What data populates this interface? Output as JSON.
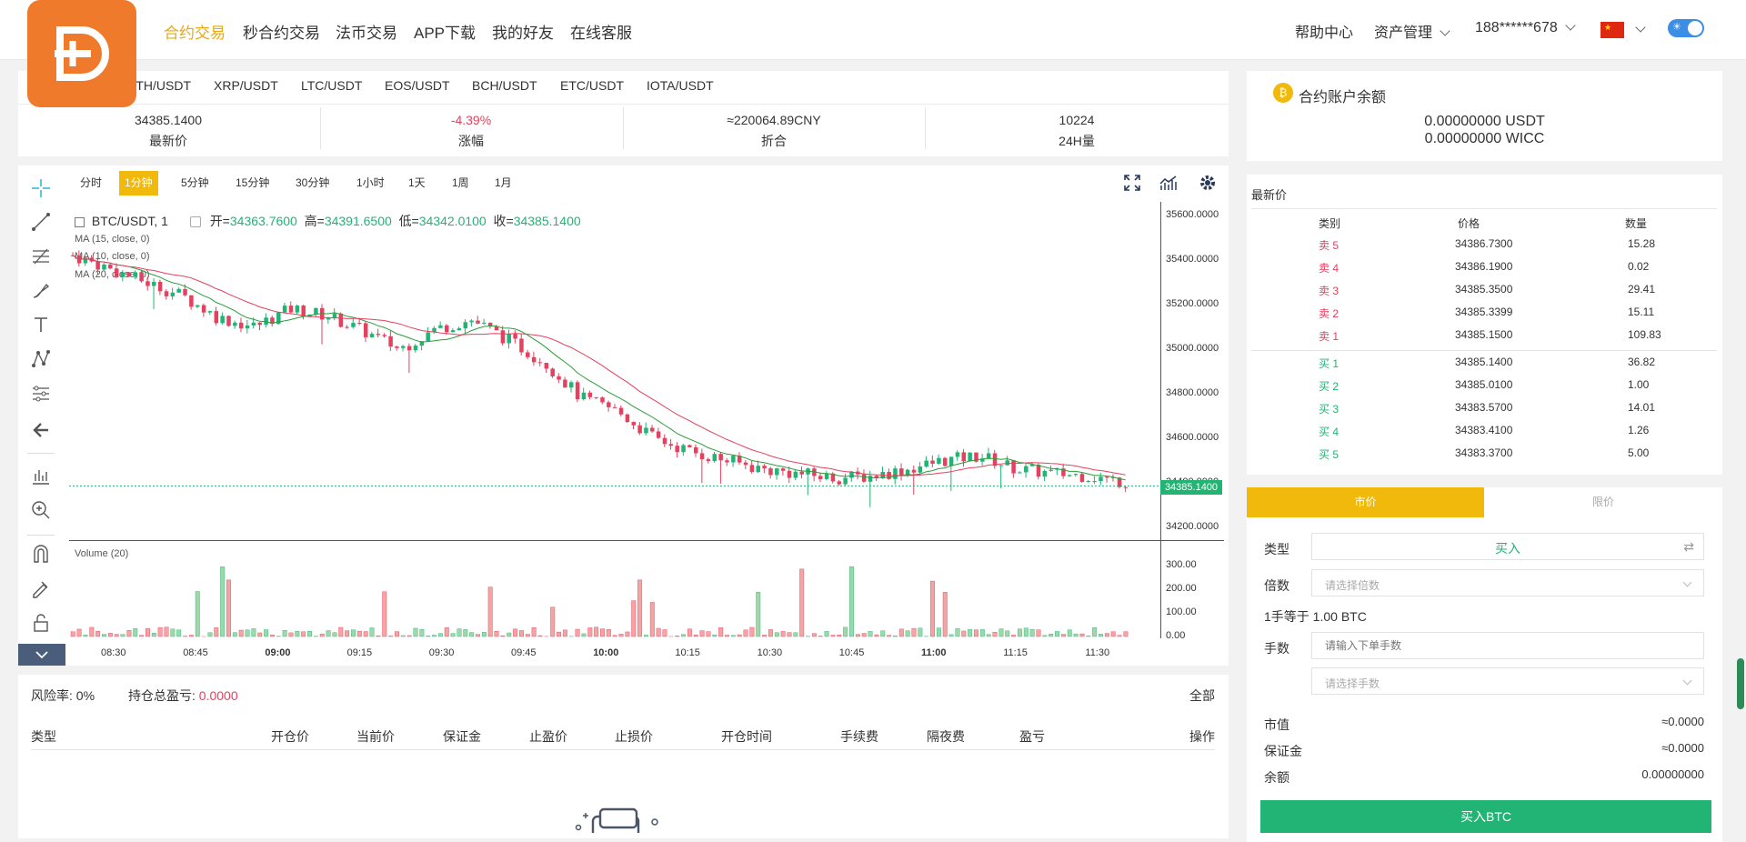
{
  "header": {
    "nav": [
      "合约交易",
      "秒合约交易",
      "法币交易",
      "APP下载",
      "我的好友",
      "在线客服"
    ],
    "help": "帮助中心",
    "assets": "资产管理",
    "user": "188******678"
  },
  "pairs": [
    "ETH/USDT",
    "XRP/USDT",
    "LTC/USDT",
    "EOS/USDT",
    "BCH/USDT",
    "ETC/USDT",
    "IOTA/USDT"
  ],
  "stats": [
    {
      "value": "34385.1400",
      "label": "最新价"
    },
    {
      "value": "-4.39%",
      "label": "涨幅"
    },
    {
      "value": "≈220064.89CNY",
      "label": "折合"
    },
    {
      "value": "10224",
      "label": "24H量"
    }
  ],
  "timeframes": [
    "分时",
    "1分钟",
    "5分钟",
    "15分钟",
    "30分钟",
    "1小时",
    "1天",
    "1周",
    "1月"
  ],
  "chart_legend": {
    "symbol": "BTC/USDT, 1",
    "open_label": "开=",
    "open": "34363.7600",
    "high_label": "高=",
    "high": "34391.6500",
    "low_label": "低=",
    "low": "34342.0100",
    "close_label": "收=",
    "close": "34385.1400",
    "ma": [
      "MA (15, close, 0)",
      "MA (10, close, 0)",
      "MA (20, close, 0)"
    ],
    "volume": "Volume (20)",
    "price_tag": "34385.1400"
  },
  "chart_data": {
    "type": "candlestick",
    "y_ticks": [
      "35600.0000",
      "35400.0000",
      "35200.0000",
      "35000.0000",
      "34800.0000",
      "34600.0000",
      "34400.0000",
      "34200.0000"
    ],
    "vol_ticks": [
      "300.00",
      "200.00",
      "100.00",
      "0.00"
    ],
    "x_ticks": [
      "08:30",
      "08:45",
      "09:00",
      "09:15",
      "09:30",
      "09:45",
      "10:00",
      "10:15",
      "10:30",
      "10:45",
      "11:00",
      "11:15",
      "11:30"
    ],
    "ylim": [
      34150,
      35660
    ],
    "current_price": 34385.14
  },
  "positions": {
    "risk_label": "风险率:",
    "risk": "0%",
    "pnl_label": "持仓总盈亏:",
    "pnl": "0.0000",
    "all": "全部",
    "columns": [
      "类型",
      "开仓价",
      "当前价",
      "保证金",
      "止盈价",
      "止损价",
      "开仓时间",
      "手续费",
      "隔夜费",
      "盈亏",
      "操作"
    ]
  },
  "account": {
    "title": "合约账户余额",
    "usdt": "0.00000000 USDT",
    "wicc": "0.00000000 WICC"
  },
  "orderbook": {
    "title": "最新价",
    "headers": [
      "类别",
      "价格",
      "数量"
    ],
    "asks": [
      {
        "label": "卖 5",
        "price": "34386.7300",
        "qty": "15.28"
      },
      {
        "label": "卖 4",
        "price": "34386.1900",
        "qty": "0.02"
      },
      {
        "label": "卖 3",
        "price": "34385.3500",
        "qty": "29.41"
      },
      {
        "label": "卖 2",
        "price": "34385.3399",
        "qty": "15.11"
      },
      {
        "label": "卖 1",
        "price": "34385.1500",
        "qty": "109.83"
      }
    ],
    "bids": [
      {
        "label": "买 1",
        "price": "34385.1400",
        "qty": "36.82"
      },
      {
        "label": "买 2",
        "price": "34385.0100",
        "qty": "1.00"
      },
      {
        "label": "买 3",
        "price": "34383.5700",
        "qty": "14.01"
      },
      {
        "label": "买 4",
        "price": "34383.4100",
        "qty": "1.26"
      },
      {
        "label": "买 5",
        "price": "34383.3700",
        "qty": "5.00"
      }
    ]
  },
  "order_form": {
    "tab_market": "市价",
    "tab_limit": "限价",
    "type_label": "类型",
    "type_value": "买入",
    "leverage_label": "倍数",
    "leverage_placeholder": "请选择倍数",
    "lot_info": "1手等于 1.00 BTC",
    "lots_label": "手数",
    "lots_placeholder": "请输入下单手数",
    "lots_select_placeholder": "请选择手数",
    "market_value_label": "市值",
    "market_value": "≈0.0000",
    "margin_label": "保证金",
    "margin": "≈0.0000",
    "balance_label": "余额",
    "balance": "0.00000000",
    "submit": "买入BTC"
  },
  "colors": {
    "accent": "#f0b90b",
    "up": "#21b474",
    "down": "#e5405e",
    "logo": "#f07a2c"
  }
}
